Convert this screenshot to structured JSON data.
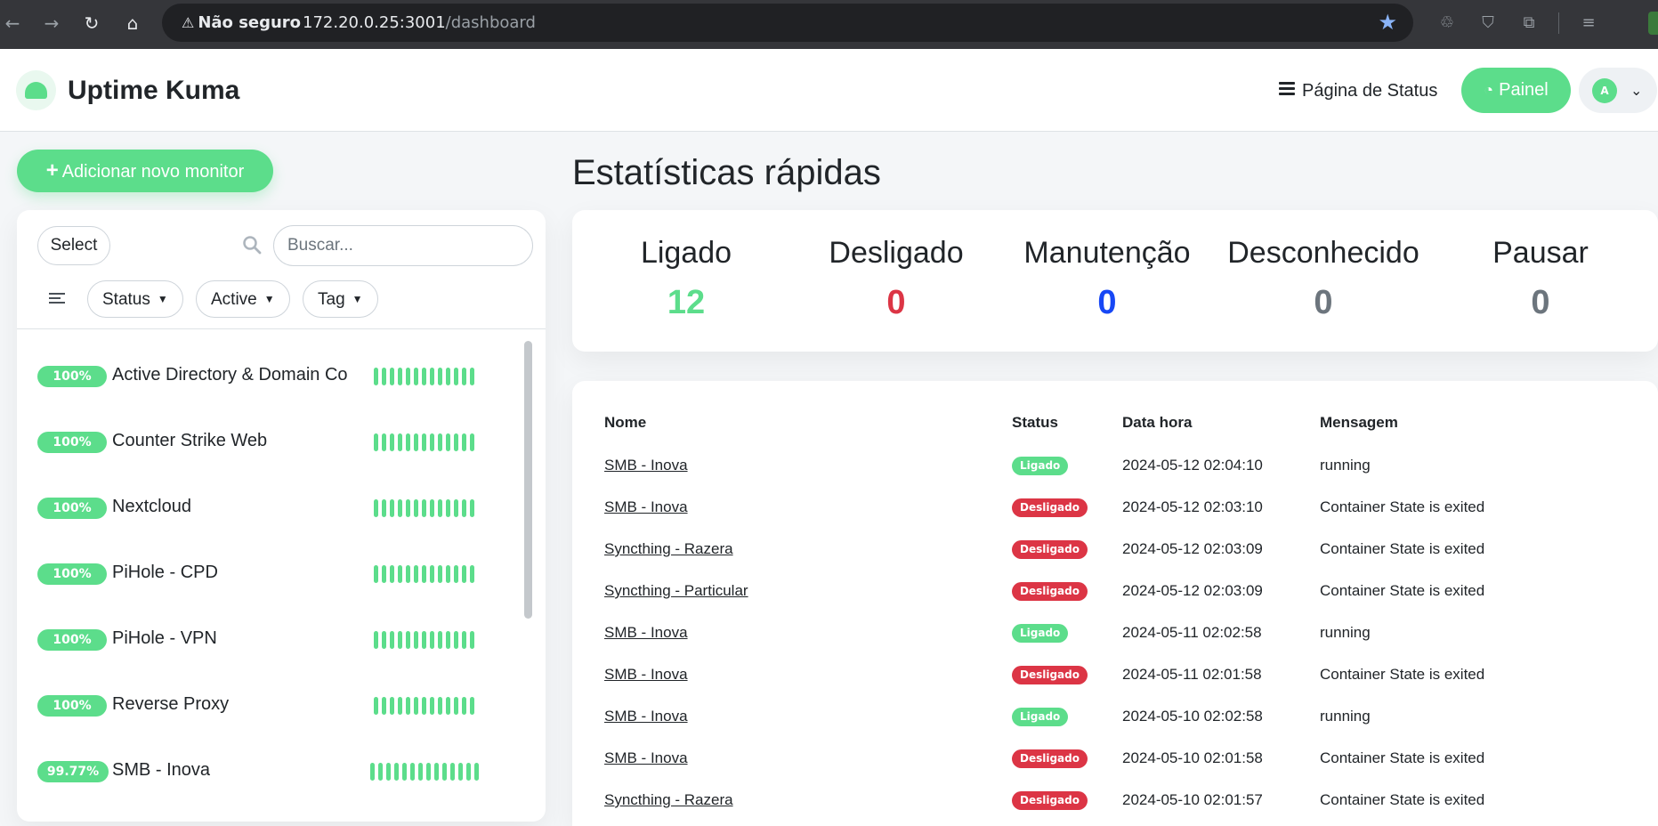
{
  "browser": {
    "security_label": "Não seguro",
    "url_host": "172.20.0.25:3001",
    "url_path": "/dashboard"
  },
  "header": {
    "brand": "Uptime Kuma",
    "status_page_label": "Página de Status",
    "dashboard_label": "Painel",
    "avatar_initial": "A"
  },
  "sidebar": {
    "add_monitor_label": "Adicionar novo monitor",
    "select_label": "Select",
    "search_placeholder": "Buscar...",
    "filters": [
      "Status",
      "Active",
      "Tag"
    ],
    "monitors": [
      {
        "uptime": "100%",
        "name": "Active Directory & Domain Co",
        "beats": 13
      },
      {
        "uptime": "100%",
        "name": "Counter Strike Web",
        "beats": 13
      },
      {
        "uptime": "100%",
        "name": "Nextcloud",
        "beats": 13
      },
      {
        "uptime": "100%",
        "name": "PiHole - CPD",
        "beats": 13
      },
      {
        "uptime": "100%",
        "name": "PiHole - VPN",
        "beats": 13
      },
      {
        "uptime": "100%",
        "name": "Reverse Proxy",
        "beats": 13
      },
      {
        "uptime": "99.77%",
        "name": "SMB - Inova",
        "beats": 14
      }
    ]
  },
  "stats": {
    "title": "Estatísticas rápidas",
    "items": [
      {
        "label": "Ligado",
        "value": "12",
        "color": "#5cdd8b"
      },
      {
        "label": "Desligado",
        "value": "0",
        "color": "#dc3545"
      },
      {
        "label": "Manutenção",
        "value": "0",
        "color": "#1747f5"
      },
      {
        "label": "Desconhecido",
        "value": "0",
        "color": "#6c757d"
      },
      {
        "label": "Pausar",
        "value": "0",
        "color": "#6c757d"
      }
    ]
  },
  "events": {
    "columns": [
      "Nome",
      "Status",
      "Data hora",
      "Mensagem"
    ],
    "rows": [
      {
        "name": "SMB - Inova",
        "status": "Ligado",
        "up": true,
        "time": "2024-05-12 02:04:10",
        "message": "running"
      },
      {
        "name": "SMB - Inova",
        "status": "Desligado",
        "up": false,
        "time": "2024-05-12 02:03:10",
        "message": "Container State is exited"
      },
      {
        "name": "Syncthing - Razera",
        "status": "Desligado",
        "up": false,
        "time": "2024-05-12 02:03:09",
        "message": "Container State is exited"
      },
      {
        "name": "Syncthing - Particular",
        "status": "Desligado",
        "up": false,
        "time": "2024-05-12 02:03:09",
        "message": "Container State is exited"
      },
      {
        "name": "SMB - Inova",
        "status": "Ligado",
        "up": true,
        "time": "2024-05-11 02:02:58",
        "message": "running"
      },
      {
        "name": "SMB - Inova",
        "status": "Desligado",
        "up": false,
        "time": "2024-05-11 02:01:58",
        "message": "Container State is exited"
      },
      {
        "name": "SMB - Inova",
        "status": "Ligado",
        "up": true,
        "time": "2024-05-10 02:02:58",
        "message": "running"
      },
      {
        "name": "SMB - Inova",
        "status": "Desligado",
        "up": false,
        "time": "2024-05-10 02:01:58",
        "message": "Container State is exited"
      },
      {
        "name": "Syncthing - Razera",
        "status": "Desligado",
        "up": false,
        "time": "2024-05-10 02:01:57",
        "message": "Container State is exited"
      }
    ]
  },
  "colors": {
    "up": "#5cdd8b",
    "down": "#dc3545",
    "maintenance": "#1747f5",
    "muted": "#6c757d"
  },
  "icons": [
    "back-icon",
    "forward-icon",
    "reload-icon",
    "home-icon",
    "warning-icon",
    "star-icon",
    "search-icon",
    "filter-icon",
    "gauge-icon",
    "chevron-down-icon"
  ]
}
